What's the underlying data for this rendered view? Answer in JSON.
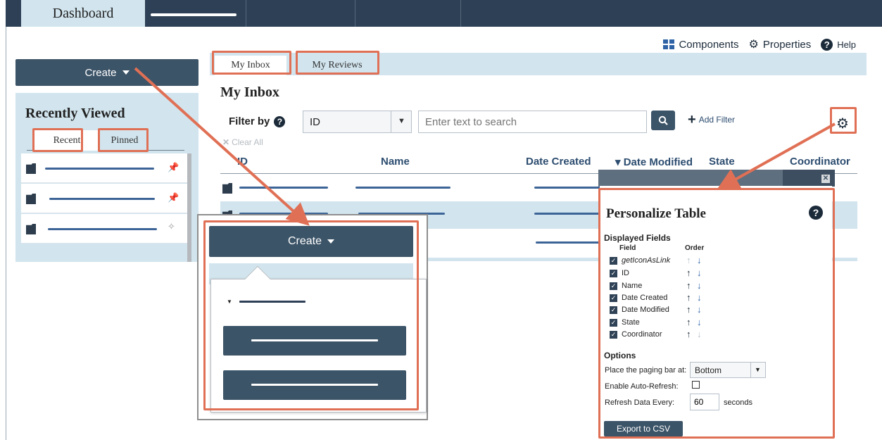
{
  "nav": {
    "dashboard_tab": "Dashboard"
  },
  "toplinks": {
    "components": "Components",
    "properties": "Properties",
    "help": "Help"
  },
  "create": {
    "label": "Create"
  },
  "recent": {
    "title": "Recently Viewed",
    "tabs": [
      "Recent",
      "Pinned"
    ]
  },
  "main": {
    "tabs": [
      "My Inbox",
      "My Reviews"
    ],
    "title": "My Inbox",
    "filter_label": "Filter by",
    "filter_field": "ID",
    "search_placeholder": "Enter text to search",
    "add_filter": "Add Filter",
    "clear_all": "Clear All",
    "columns": [
      "ID",
      "Name",
      "Date Created",
      "Date Modified",
      "State",
      "Coordinator"
    ]
  },
  "personalize": {
    "title": "Personalize Table",
    "displayed_fields": "Displayed Fields",
    "field_header": "Field",
    "order_header": "Order",
    "fields": [
      "getIconAsLink",
      "ID",
      "Name",
      "Date Created",
      "Date Modified",
      "State",
      "Coordinator"
    ],
    "options_title": "Options",
    "paging_label": "Place the paging bar at:",
    "paging_value": "Bottom",
    "auto_refresh_label": "Enable Auto-Refresh:",
    "refresh_label": "Refresh Data Every:",
    "refresh_value": "60",
    "refresh_unit": "seconds",
    "export_label": "Export to CSV"
  },
  "colors": {
    "nav": "#2e4055",
    "accent": "#e07055",
    "button": "#3c5468",
    "panel": "#d2e5ee"
  }
}
